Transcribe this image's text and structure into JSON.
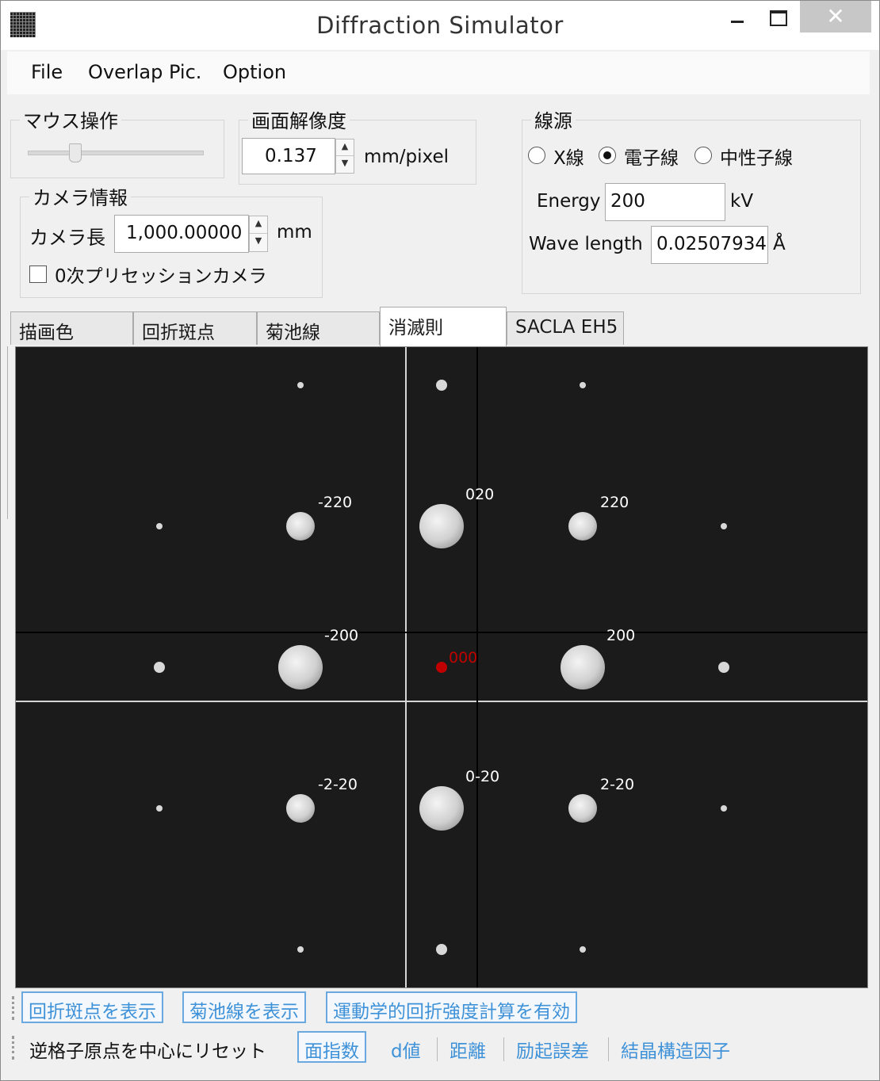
{
  "window": {
    "title": "Diffraction Simulator",
    "minimize": "–",
    "maximize": "□",
    "close": "✕"
  },
  "menu": [
    "File",
    "Overlap Pic.",
    "Option"
  ],
  "mouse_group": {
    "label": "マウス操作"
  },
  "resolution": {
    "label": "画面解像度",
    "value": "0.137",
    "unit": "mm/pixel"
  },
  "camera": {
    "label": "カメラ情報",
    "length_label": "カメラ長",
    "length_value": "1,000.00000",
    "length_unit": "mm",
    "precession_label": "0次プリセッションカメラ",
    "precession_checked": false
  },
  "source": {
    "label": "線源",
    "options": [
      {
        "label": "X線",
        "selected": false
      },
      {
        "label": "電子線",
        "selected": true
      },
      {
        "label": "中性子線",
        "selected": false
      }
    ],
    "energy_label": "Energy",
    "energy_value": "200",
    "energy_unit": "kV",
    "wavelength_label": "Wave length",
    "wavelength_value": "0.02507934",
    "wavelength_unit": "Å"
  },
  "tabs": [
    {
      "label": "描画色",
      "active": false
    },
    {
      "label": "回折斑点",
      "active": false
    },
    {
      "label": "菊池線",
      "active": false
    },
    {
      "label": "消滅則",
      "active": true
    },
    {
      "label": "SACLA EH5",
      "active": false
    }
  ],
  "pattern": {
    "origin_color": "#c00000",
    "spot_color": "#d8d8d8",
    "label_color": "#ffffff",
    "spots": [
      {
        "label": "000",
        "h": 0,
        "k": 0,
        "size": "origin"
      },
      {
        "label": "200",
        "h": 2,
        "k": 0,
        "size": "large"
      },
      {
        "label": "-200",
        "h": -2,
        "k": 0,
        "size": "large"
      },
      {
        "label": "020",
        "h": 0,
        "k": 2,
        "size": "large"
      },
      {
        "label": "0-20",
        "h": 0,
        "k": -2,
        "size": "large"
      },
      {
        "label": "220",
        "h": 2,
        "k": 2,
        "size": "medium"
      },
      {
        "label": "-220",
        "h": -2,
        "k": 2,
        "size": "medium"
      },
      {
        "label": "2-20",
        "h": 2,
        "k": -2,
        "size": "medium"
      },
      {
        "label": "-2-20",
        "h": -2,
        "k": -2,
        "size": "medium"
      },
      {
        "label": "",
        "h": 4,
        "k": 0,
        "size": "small"
      },
      {
        "label": "",
        "h": -4,
        "k": 0,
        "size": "small"
      },
      {
        "label": "",
        "h": 0,
        "k": 4,
        "size": "small"
      },
      {
        "label": "",
        "h": 0,
        "k": -4,
        "size": "small"
      },
      {
        "label": "",
        "h": 4,
        "k": 2,
        "size": "tiny"
      },
      {
        "label": "",
        "h": -4,
        "k": 2,
        "size": "tiny"
      },
      {
        "label": "",
        "h": 4,
        "k": -2,
        "size": "tiny"
      },
      {
        "label": "",
        "h": -4,
        "k": -2,
        "size": "tiny"
      },
      {
        "label": "",
        "h": 2,
        "k": 4,
        "size": "tiny"
      },
      {
        "label": "",
        "h": -2,
        "k": 4,
        "size": "tiny"
      },
      {
        "label": "",
        "h": 2,
        "k": -4,
        "size": "tiny"
      },
      {
        "label": "",
        "h": -2,
        "k": -4,
        "size": "tiny"
      }
    ]
  },
  "toolbar1": [
    "回折斑点を表示",
    "菊池線を表示",
    "運動学的回折強度計算を有効"
  ],
  "toolbar2": {
    "reset_label": "逆格子原点を中心にリセット",
    "active_option": "面指数",
    "options": [
      "d値",
      "距離",
      "励起誤差",
      "結晶構造因子"
    ]
  }
}
